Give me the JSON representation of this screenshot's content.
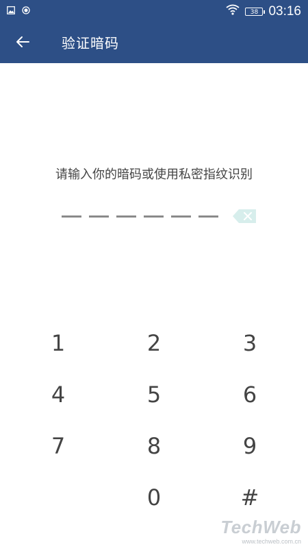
{
  "status_bar": {
    "left_icons": [
      "image-icon",
      "record-icon"
    ],
    "right_icons": [
      "wifi-icon",
      "battery-icon"
    ],
    "battery_level": "38",
    "time": "03:16"
  },
  "app_bar": {
    "back_icon": "arrow-left-icon",
    "title": "验证暗码"
  },
  "prompt": "请输入你的暗码或使用私密指纹识别",
  "pin": {
    "length": 6,
    "entered": 0,
    "delete_icon": "backspace-icon"
  },
  "keypad": {
    "keys": [
      "1",
      "2",
      "3",
      "4",
      "5",
      "6",
      "7",
      "8",
      "9",
      "",
      "0",
      "#"
    ]
  },
  "watermark": {
    "logo": "TechWeb",
    "url": "www.techweb.com.cn"
  },
  "colors": {
    "primary": "#2d4f86",
    "background": "#ffffff",
    "text": "#444444",
    "delete_button": "#d7eeec"
  }
}
